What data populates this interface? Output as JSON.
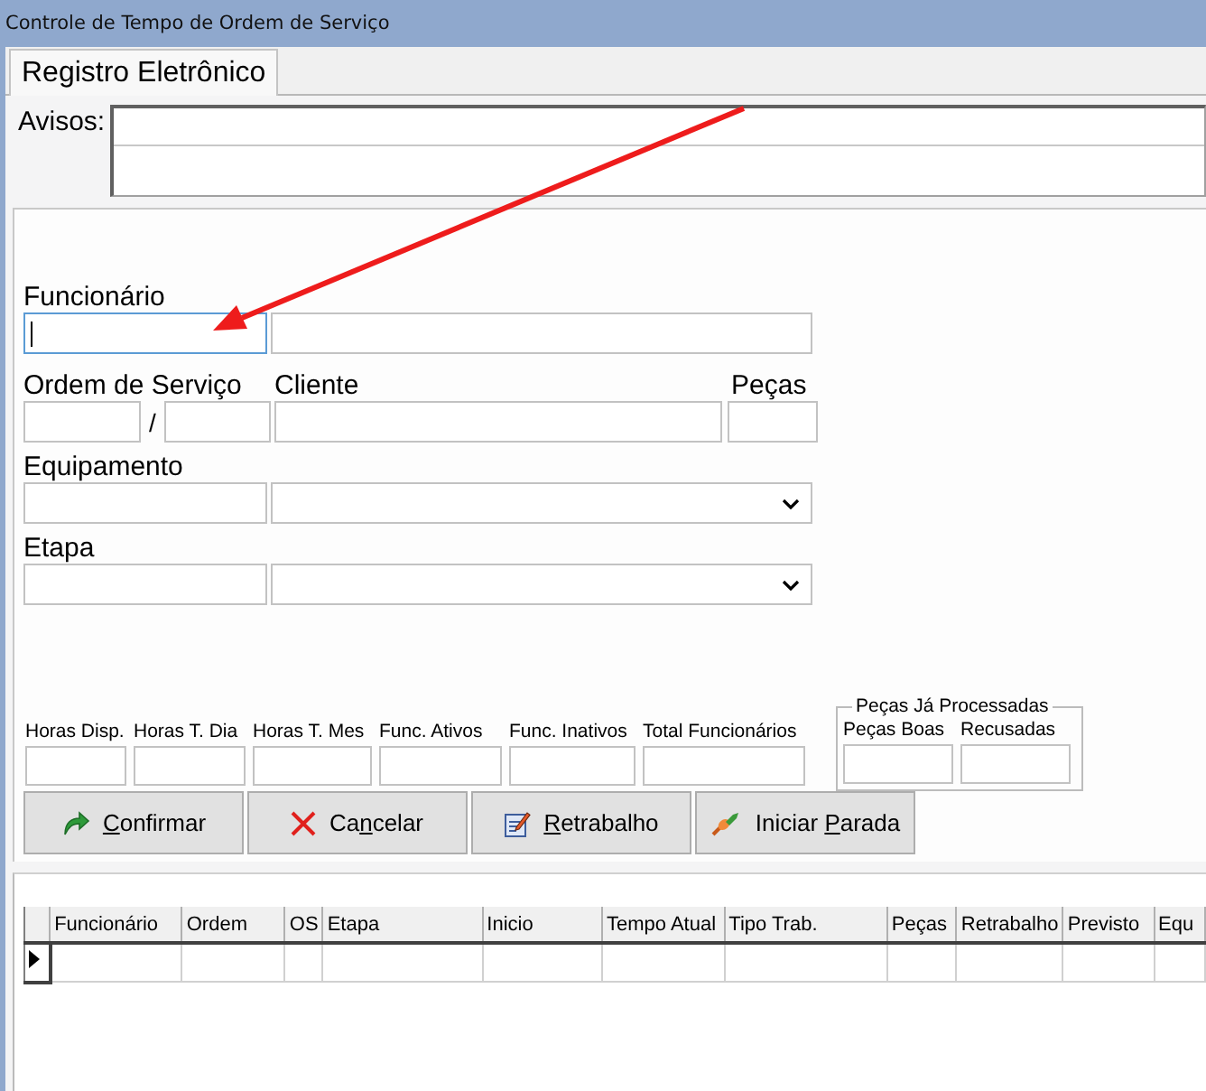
{
  "window": {
    "title": "Controle de Tempo de Ordem de Serviço"
  },
  "tabs": [
    {
      "label": "Registro Eletrônico",
      "selected": true
    }
  ],
  "avisos": {
    "label": "Avisos:"
  },
  "form": {
    "funcionario_label": "Funcionário",
    "funcionario_focused": true,
    "ordem_label": "Ordem de Serviço",
    "separator": "/",
    "cliente_label": "Cliente",
    "pecas_label": "Peças",
    "equipamento_label": "Equipamento",
    "etapa_label": "Etapa"
  },
  "stats": [
    {
      "label": "Horas Disp."
    },
    {
      "label": "Horas T. Dia"
    },
    {
      "label": "Horas T. Mes"
    },
    {
      "label": "Func. Ativos"
    },
    {
      "label": "Func. Inativos"
    },
    {
      "label": "Total Funcionários"
    }
  ],
  "processed_group": {
    "title": "Peças Já Processadas",
    "fields": [
      {
        "label": "Peças Boas"
      },
      {
        "label": "Recusadas"
      }
    ]
  },
  "buttons": [
    {
      "accel": "C",
      "after": "onfirmar"
    },
    {
      "before": "Ca",
      "accel": "n",
      "after": "celar"
    },
    {
      "accel": "R",
      "after": "etrabalho"
    },
    {
      "before": "Iniciar ",
      "accel": "P",
      "after": "arada"
    }
  ],
  "grid": {
    "columns": [
      "Funcionário",
      "Ordem",
      "OS",
      "Etapa",
      "Inicio",
      "Tempo Atual",
      "Tipo Trab.",
      "Peças",
      "Retrabalho",
      "Previsto",
      "Equ"
    ],
    "rows": [
      {
        "current": true
      }
    ]
  }
}
